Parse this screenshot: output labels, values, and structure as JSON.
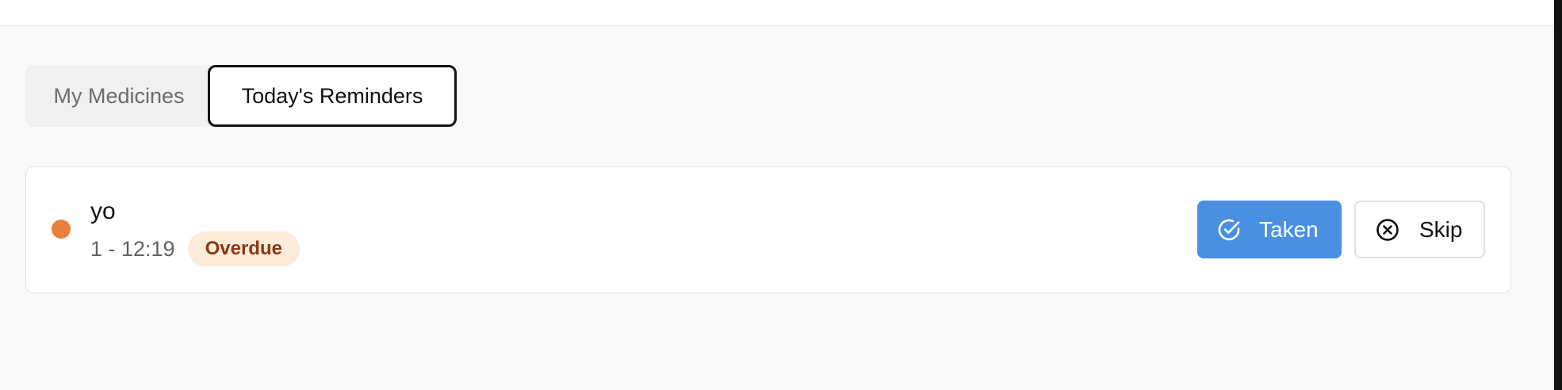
{
  "tabs": [
    {
      "label": "My Medicines",
      "active": false
    },
    {
      "label": "Today's Reminders",
      "active": true
    }
  ],
  "reminder": {
    "name": "yo",
    "time": "1 - 12:19",
    "status": "Overdue",
    "status_dot_color": "#e8813a",
    "badge_bg_color": "#fdebd9",
    "badge_text_color": "#8a3a13"
  },
  "actions": {
    "taken_label": "Taken",
    "taken_icon": "check-circle-icon",
    "taken_color": "#4a90e2",
    "skip_label": "Skip",
    "skip_icon": "x-circle-icon"
  }
}
